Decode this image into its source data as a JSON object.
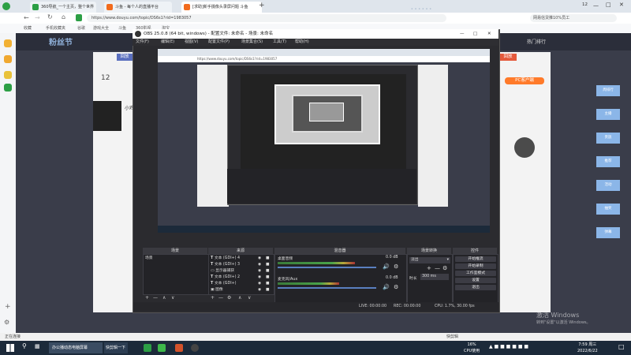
{
  "browser": {
    "tabs": [
      {
        "label": "360导航_一个主页，整个世界",
        "color": "#2c9f45"
      },
      {
        "label": "斗鱼 - 每个人的直播平台",
        "color": "#f26b1d"
      },
      {
        "label": "[求助]新手摄像头录屏问题 斗鱼",
        "color": "#f26b1d"
      }
    ],
    "url": "https://www.douyu.com/topic/DS6s1?rid=1983057",
    "search_hint": "网易信贷推10%员工",
    "bookmarks": [
      "收藏",
      "手机收藏夹",
      "谷歌",
      "游戏大全",
      "斗鱼",
      "360影视",
      "淘宝"
    ],
    "user_badge": "12",
    "status_left": "正在连接",
    "bottom_label": "快剪辑"
  },
  "douyu": {
    "banner": "粉丝节",
    "count": "12",
    "streamer": "小鸡崽",
    "btn_back": "回放",
    "btn_pc": "PC客户端",
    "hot_label": "热门排行",
    "right_chips": [
      "我看TA",
      "赏月人数",
      "打赏",
      "送礼"
    ],
    "sidebar_tags": [
      "周排行",
      "主播",
      "贵族",
      "推荐",
      "活动",
      "抽奖",
      "弹幕"
    ]
  },
  "obs": {
    "title": "OBS 25.0.8 (64 bit, windows) - 配置文件: 未命名 - 场景: 未命名",
    "menu": [
      "文件(F)",
      "编辑(E)",
      "视图(V)",
      "配置文件(P)",
      "场景集合(S)",
      "工具(T)",
      "帮助(H)"
    ],
    "docks": {
      "scenes": "场景",
      "sources": "来源",
      "mixer": "混音器",
      "transitions": "场景转换",
      "controls": "控件"
    },
    "scene_items": [
      "场景"
    ],
    "sources": [
      {
        "name": "文本 (GDI+) 4",
        "icon": "text-icon"
      },
      {
        "name": "文本 (GDI+) 3",
        "icon": "text-icon"
      },
      {
        "name": "显示器捕获",
        "icon": "monitor-icon"
      },
      {
        "name": "文本 (GDI+) 2",
        "icon": "text-icon"
      },
      {
        "name": "文本 (GDI+)",
        "icon": "text-icon"
      },
      {
        "name": "图像",
        "icon": "image-icon"
      }
    ],
    "mixer": [
      {
        "name": "桌面音频",
        "db": "0.0 dB",
        "level": 0.78
      },
      {
        "name": "麦克风/Aux",
        "db": "0.0 dB",
        "level": 0.62
      }
    ],
    "transition": {
      "type": "淡出",
      "duration_label": "时长",
      "duration": "300 ms"
    },
    "controls": [
      "开始推流",
      "开始录制",
      "工作室模式",
      "设置",
      "退出"
    ],
    "status": {
      "live": "LIVE: 00:00:00",
      "rec": "REC: 00:00:00",
      "cpu": "CPU: 1.7%, 30.00 fps"
    }
  },
  "windows": {
    "activate_title": "激活 Windows",
    "activate_sub": "转到\"设置\"以激活 Windows。",
    "taskbar_app": "办公播动态电脑屏幕",
    "taskbar_app2": "快剪辑一下",
    "cpu": "16%",
    "cpu_label": "CPU使用",
    "time": "7:59 周三",
    "date": "2022/6/22"
  }
}
